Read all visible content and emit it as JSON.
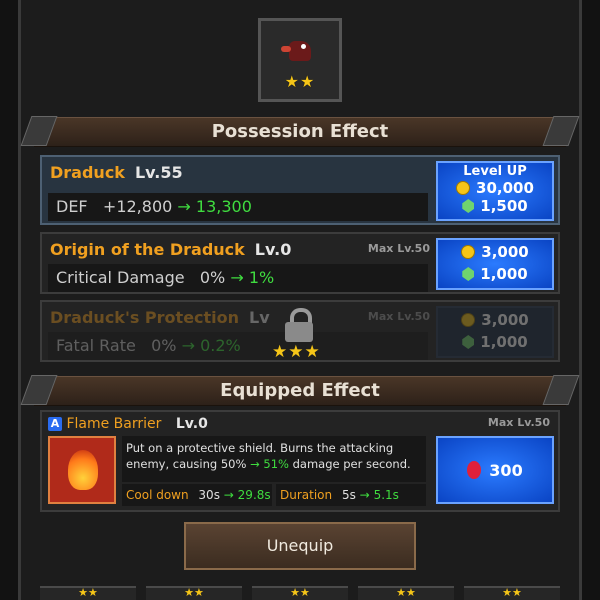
{
  "portrait": {
    "stars": "★★"
  },
  "possession": {
    "title": "Possession Effect",
    "draduck": {
      "name": "Draduck",
      "level": "Lv.55",
      "stat": "DEF",
      "from": "+12,800",
      "arrow": "→",
      "to": "13,300",
      "button": {
        "title": "Level UP",
        "gold": "30,000",
        "gem": "1,500"
      }
    },
    "origin": {
      "name": "Origin of the Draduck",
      "level": "Lv.0",
      "max": "Max Lv.50",
      "stat": "Critical Damage",
      "from": "0%",
      "arrow": "→",
      "to": "1%",
      "gold": "3,000",
      "gem": "1,000"
    },
    "protection": {
      "name": "Draduck's Protection",
      "level": "Lv",
      "max": "Max Lv.50",
      "stat": "Fatal Rate",
      "from": "0%",
      "arrow": "→",
      "to": "0.2%",
      "gold": "3,000",
      "gem": "1,000",
      "lock_stars": "★★★"
    }
  },
  "equipped": {
    "title": "Equipped Effect",
    "badge": "A",
    "skill_name": "Flame Barrier",
    "level": "Lv.0",
    "max": "Max Lv.50",
    "description_line1": "Put on a protective shield. Burns the attacking",
    "description_line2_a": "enemy, causing 50%",
    "description_line2_arrow": "→",
    "description_line2_b": "51%",
    "description_line2_c": "damage per second.",
    "cooldown": {
      "label": "Cool down",
      "from": "30s",
      "arrow": "→",
      "to": "29.8s"
    },
    "duration": {
      "label": "Duration",
      "from": "5s",
      "arrow": "→",
      "to": "5.1s"
    },
    "cost": "300"
  },
  "unequip_label": "Unequip",
  "bottom_tabs": [
    "★★",
    "★★",
    "★★",
    "★★",
    "★★"
  ]
}
